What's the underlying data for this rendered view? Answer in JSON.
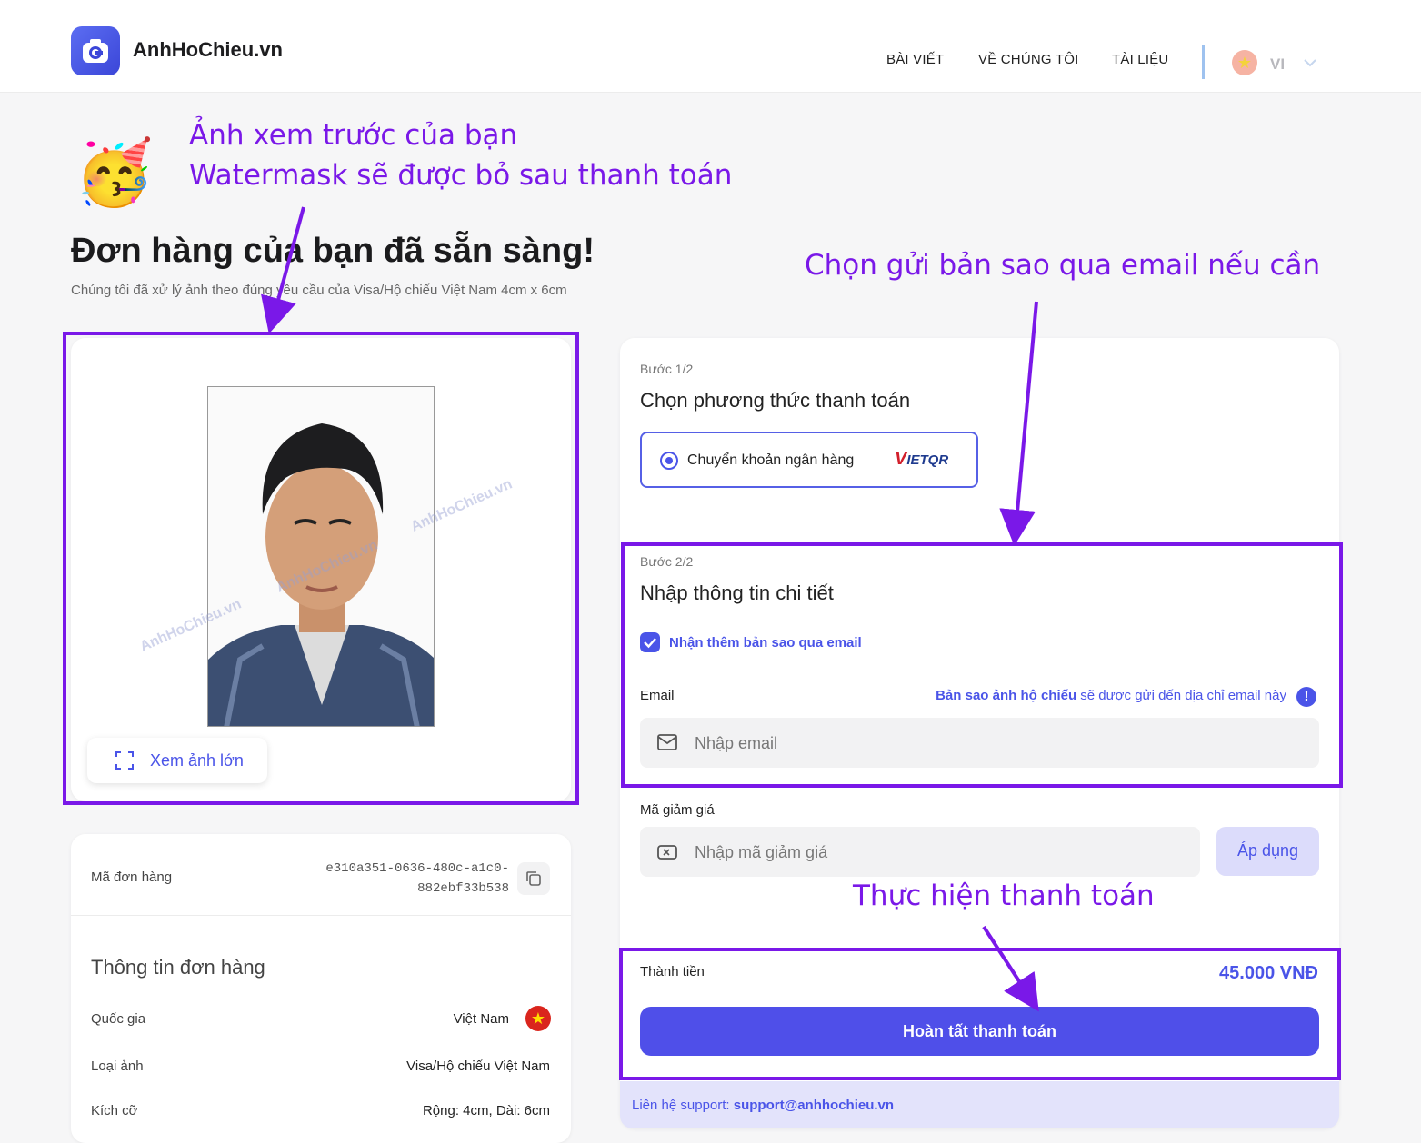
{
  "header": {
    "brand": "AnhHoChieu.vn",
    "nav": [
      "BÀI VIẾT",
      "VỀ CHÚNG TÔI",
      "TÀI LIỆU"
    ],
    "lang": "VI"
  },
  "annotations": {
    "preview_line1": "Ảnh xem trước của bạn",
    "preview_line2": "Watermask sẽ được bỏ sau thanh toán",
    "email_hint": "Chọn gửi bản sao qua email nếu cần",
    "pay_hint": "Thực hiện thanh toán"
  },
  "hero": {
    "emoji": "🥳",
    "title": "Đơn hàng của bạn đã sẵn sàng!",
    "subtitle": "Chúng tôi đã xử lý ảnh theo đúng yêu cầu của Visa/Hộ chiếu Việt Nam 4cm x 6cm"
  },
  "preview": {
    "watermark": "AnhHoChieu.vn",
    "view_large": "Xem ảnh lớn"
  },
  "order": {
    "id_label": "Mã đơn hàng",
    "id_line1": "e310a351-0636-480c-a1c0-",
    "id_line2": "882ebf33b538",
    "info_title": "Thông tin đơn hàng",
    "country_label": "Quốc gia",
    "country_value": "Việt Nam",
    "type_label": "Loại ảnh",
    "type_value": "Visa/Hộ chiếu Việt Nam",
    "size_label": "Kích cỡ",
    "size_value": "Rộng: 4cm, Dài: 6cm"
  },
  "payment": {
    "step1": "Bước 1/2",
    "step1_title": "Chọn phương thức thanh toán",
    "method": "Chuyển khoản ngân hàng",
    "method_logo": "VIETQR",
    "step2": "Bước 2/2",
    "step2_title": "Nhập thông tin chi tiết",
    "email_copy": "Nhận thêm bản sao qua email",
    "email_label": "Email",
    "email_note_bold": "Bản sao ảnh hộ chiếu",
    "email_note_rest": " sẽ được gửi đến địa chỉ email này",
    "email_placeholder": "Nhập email",
    "discount_label": "Mã giảm giá",
    "discount_placeholder": "Nhập mã giảm giá",
    "apply": "Áp dụng",
    "total_label": "Thành tiền",
    "total_value": "45.000 VNĐ",
    "submit": "Hoàn tất thanh toán",
    "support_label": "Liên hệ support: ",
    "support_email": "support@anhhochieu.vn"
  },
  "colors": {
    "accent": "#4f4fe9",
    "annotation": "#7a18e8"
  }
}
